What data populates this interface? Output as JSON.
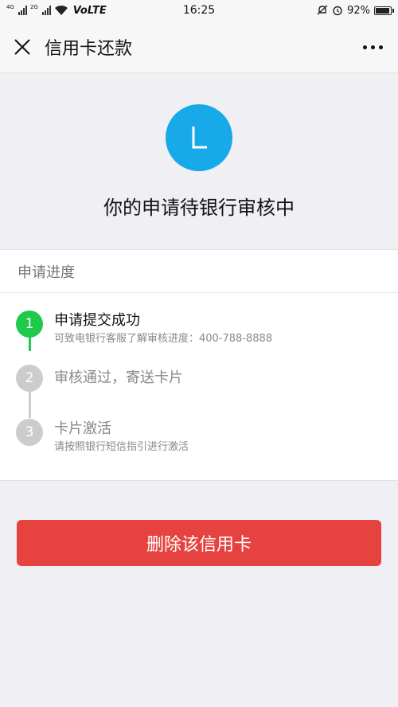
{
  "status_bar": {
    "sim1_label": "4G",
    "sim2_label": "2G",
    "volte": "VoLTE",
    "time": "16:25",
    "battery_text": "92%",
    "battery_level": 0.92
  },
  "header": {
    "title": "信用卡还款"
  },
  "hero": {
    "logo_letter": "L",
    "logo_color": "#17a9e8",
    "status_text": "你的申请待银行审核中"
  },
  "progress": {
    "section_title": "申请进度",
    "steps": [
      {
        "number": "1",
        "title": "申请提交成功",
        "subtitle": "可致电银行客服了解审核进度：400-788-8888",
        "active": true
      },
      {
        "number": "2",
        "title": "审核通过，寄送卡片",
        "subtitle": "",
        "active": false
      },
      {
        "number": "3",
        "title": "卡片激活",
        "subtitle": "请按照银行短信指引进行激活",
        "active": false
      }
    ],
    "active_color": "#1fc94b",
    "inactive_color": "#cccccc"
  },
  "actions": {
    "delete_label": "删除该信用卡",
    "delete_color": "#e64340"
  }
}
